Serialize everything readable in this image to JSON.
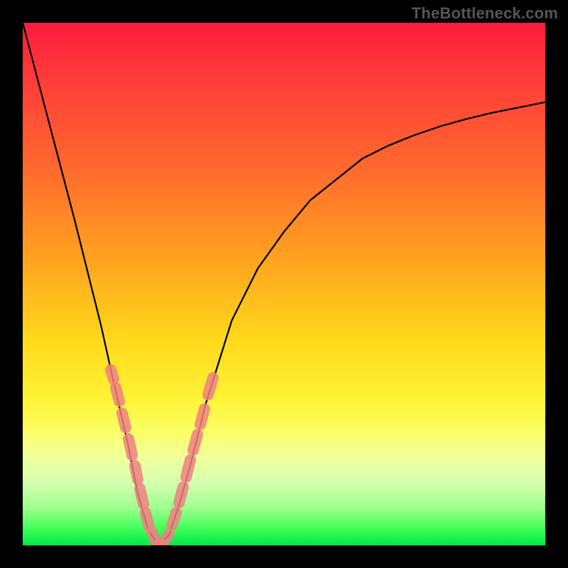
{
  "watermark": "TheBottleneck.com",
  "colors": {
    "frame": "#000000",
    "curve": "#000000",
    "dots": "#f08080",
    "gradient_stops": [
      "#ff1a3c",
      "#ff6a2d",
      "#ffd71a",
      "#fbff63",
      "#3bff55",
      "#00e84a"
    ]
  },
  "chart_data": {
    "type": "line",
    "title": "",
    "xlabel": "",
    "ylabel": "",
    "xlim": [
      0,
      100
    ],
    "ylim": [
      0,
      100
    ],
    "x": [
      0,
      5,
      10,
      15,
      17,
      20,
      22,
      24,
      26,
      28,
      30,
      32,
      35,
      40,
      45,
      50,
      55,
      60,
      65,
      70,
      75,
      80,
      85,
      90,
      95,
      100
    ],
    "y": [
      100,
      81,
      62,
      42,
      33,
      20,
      10,
      3,
      0,
      2,
      8,
      15,
      27,
      43,
      53,
      60,
      66,
      70,
      74,
      76.5,
      78.5,
      80.2,
      81.6,
      82.8,
      83.8,
      84.8
    ],
    "notes": "V-shaped bottleneck curve; minimum ≈0 at x≈26. Pink bead markers overlay the lower portion of the V (both arms) between y≈0 and y≈35."
  }
}
